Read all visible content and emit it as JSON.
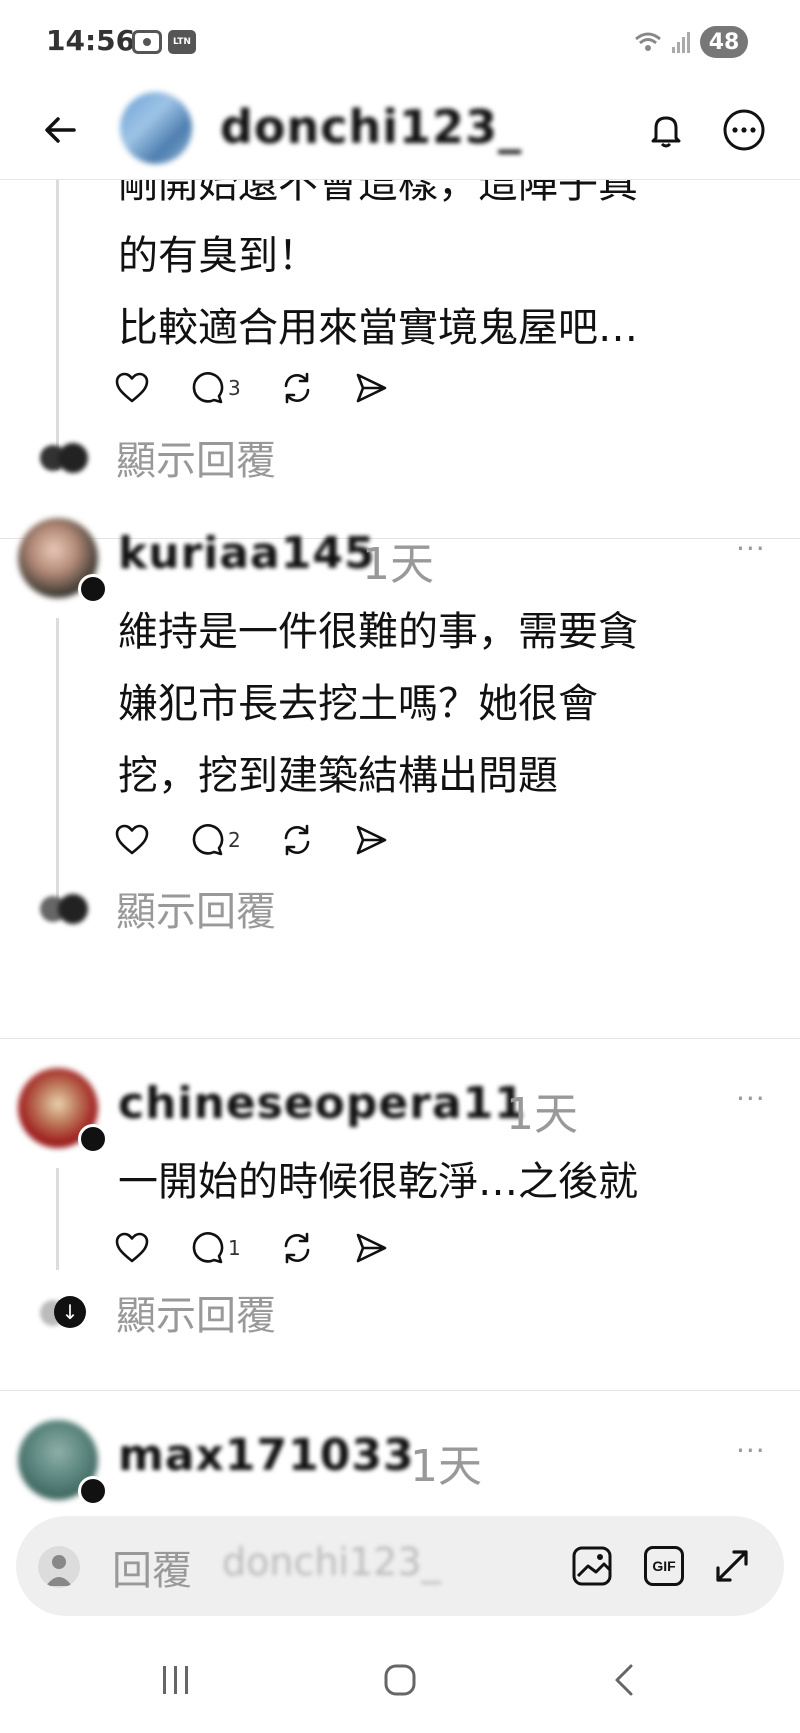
{
  "status_bar": {
    "time": "14:56",
    "carrier_badge": "LTN",
    "battery": "48"
  },
  "header": {
    "username": "donchi123_"
  },
  "posts": [
    {
      "text_lines": [
        "剛開始還不會這樣，這陣子真",
        "的有臭到！",
        "比較適合用來當實境鬼屋吧…"
      ],
      "reply_count": "3",
      "show_replies_label": "顯示回覆"
    },
    {
      "username": "kuriaa145",
      "time": "1天",
      "more": "···",
      "text_lines": [
        "維持是一件很難的事，需要貪",
        "嫌犯市長去挖土嗎？她很會",
        "挖，挖到建築結構出問題"
      ],
      "reply_count": "2",
      "show_replies_label": "顯示回覆"
    },
    {
      "username": "chineseopera11",
      "time": "1天",
      "more": "···",
      "text_lines": [
        "一開始的時候很乾淨…之後就"
      ],
      "reply_count": "1",
      "show_replies_label": "顯示回覆"
    },
    {
      "username": "max171033",
      "time": "1天",
      "more": "···"
    }
  ],
  "reply_bar": {
    "placeholder": "回覆",
    "target_user": "donchi123_",
    "gif_label": "GIF"
  },
  "colors": {
    "text": "#111111",
    "secondary": "#999999",
    "divider": "#e4e4e4",
    "reply_bar_bg": "#efefef"
  }
}
